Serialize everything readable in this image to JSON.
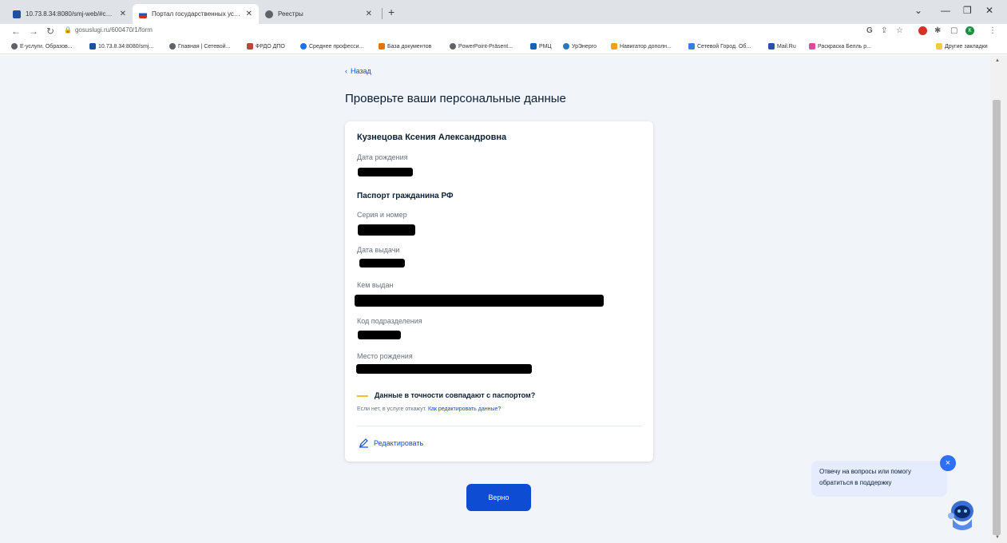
{
  "browser": {
    "tabs": [
      {
        "title": "10.73.8.34:8080/smj-web/#collo",
        "active": false
      },
      {
        "title": "Портал государственных услуг",
        "active": true
      },
      {
        "title": "Реестры",
        "active": false
      }
    ],
    "address": "gosuslugi.ru/600470/1/form",
    "bookmarks": [
      "Е-услуги. Образов...",
      "10.73.8.34:8080/smj...",
      "Главная | Сетевой...",
      "ФРДО ДПО",
      "Среднее професси...",
      "База документов",
      "PowerPoint-Präsent...",
      "РМЦ",
      "УрЭнерго",
      "Навигатор дополн...",
      "Сетевой Город. Об...",
      "Mail.Ru",
      "Раскраска Белль р...",
      "Другие закладки"
    ],
    "profile_initial": "К"
  },
  "page": {
    "back_label": "Назад",
    "title": "Проверьте ваши персональные данные",
    "full_name": "Кузнецова Ксения Александровна",
    "birth_date_label": "Дата рождения",
    "passport_section": "Паспорт гражданина РФ",
    "series_label": "Серия и номер",
    "issue_date_label": "Дата выдачи",
    "issued_by_label": "Кем выдан",
    "dept_code_label": "Код подразделения",
    "birth_place_label": "Место рождения",
    "question": "Данные в точности совпадают с паспортом?",
    "hint_text": "Если нет, в услуге откажут.",
    "hint_link": "Как редактировать данные?",
    "edit_label": "Редактировать",
    "confirm_label": "Верно"
  },
  "chat": {
    "message": "Отвечу на вопросы или помогу обратиться в поддержку",
    "close": "×"
  },
  "colors": {
    "accent": "#0d4cd3",
    "page_bg": "#f1f4f8",
    "warn_line": "#f5c12e"
  }
}
